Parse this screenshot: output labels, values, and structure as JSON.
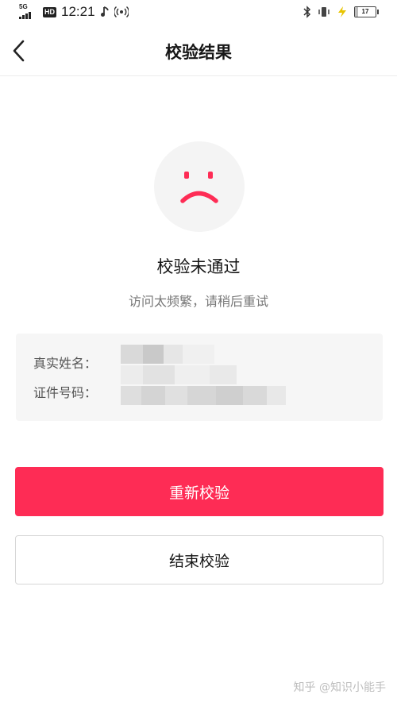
{
  "status_bar": {
    "network": "5G",
    "hd": "HD",
    "time": "12:21",
    "battery": "17",
    "battery_level": 0.17
  },
  "nav": {
    "title": "校验结果",
    "back_icon": "chevron-left-icon"
  },
  "result": {
    "icon": "sad-face-icon",
    "title": "校验未通过",
    "description": "访问太频繁，请稍后重试"
  },
  "info": {
    "name_label": "真实姓名：",
    "id_label": "证件号码："
  },
  "actions": {
    "retry_label": "重新校验",
    "end_label": "结束校验"
  },
  "watermark": "知乎 @知识小能手",
  "colors": {
    "accent": "#fe2c55",
    "card_bg": "#f6f6f6",
    "icon_bg": "#f4f4f4"
  }
}
